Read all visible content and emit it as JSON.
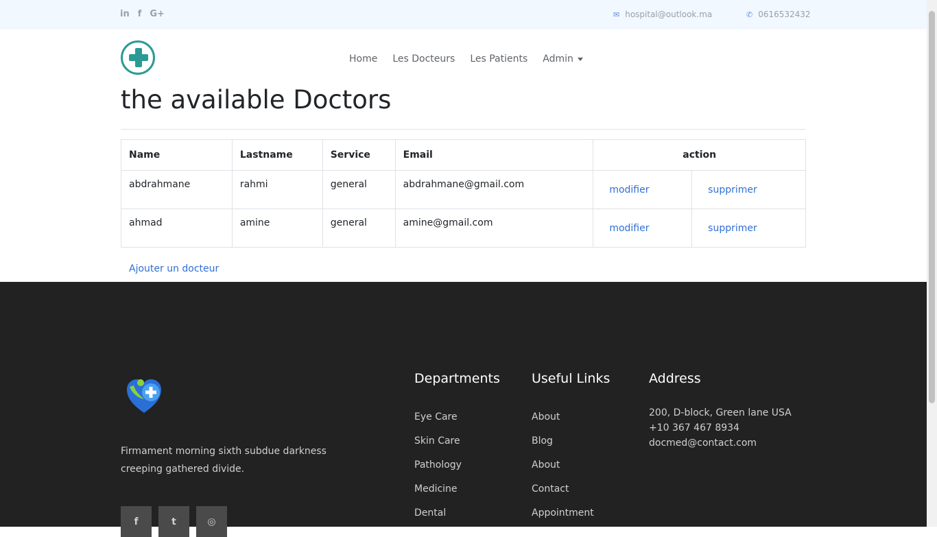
{
  "topbar": {
    "social": [
      "in",
      "f",
      "G+"
    ],
    "email": "hospital@outlook.ma",
    "phone": "0616532432"
  },
  "nav": {
    "items": [
      "Home",
      "Les Docteurs",
      "Les Patients"
    ],
    "admin": "Admin"
  },
  "page_title": "the available Doctors",
  "table": {
    "headers": [
      "Name",
      "Lastname",
      "Service",
      "Email",
      "action"
    ],
    "rows": [
      {
        "name": "abdrahmane",
        "lastname": "rahmi",
        "service": "general",
        "email": "abdrahmane@gmail.com",
        "edit": "modifier",
        "delete": "supprimer"
      },
      {
        "name": "ahmad",
        "lastname": "amine",
        "service": "general",
        "email": "amine@gmail.com",
        "edit": "modifier",
        "delete": "supprimer"
      }
    ]
  },
  "add_link": "Ajouter un docteur",
  "footer": {
    "description": "Firmament morning sixth subdue darkness creeping gathered divide.",
    "social": [
      "f",
      "t",
      "◎"
    ],
    "departments": {
      "title": "Departments",
      "items": [
        "Eye Care",
        "Skin Care",
        "Pathology",
        "Medicine",
        "Dental"
      ]
    },
    "links": {
      "title": "Useful Links",
      "items": [
        "About",
        "Blog",
        "About",
        "Contact",
        "Appointment"
      ]
    },
    "address": {
      "title": "Address",
      "lines": [
        "200, D-block, Green lane USA",
        "+10 367 467 8934",
        "docmed@contact.com"
      ]
    }
  },
  "colors": {
    "accent": "#2b9a95",
    "link": "#2f6fd6",
    "footer_bg": "#222222",
    "topbar_bg": "#f2f8ff"
  }
}
